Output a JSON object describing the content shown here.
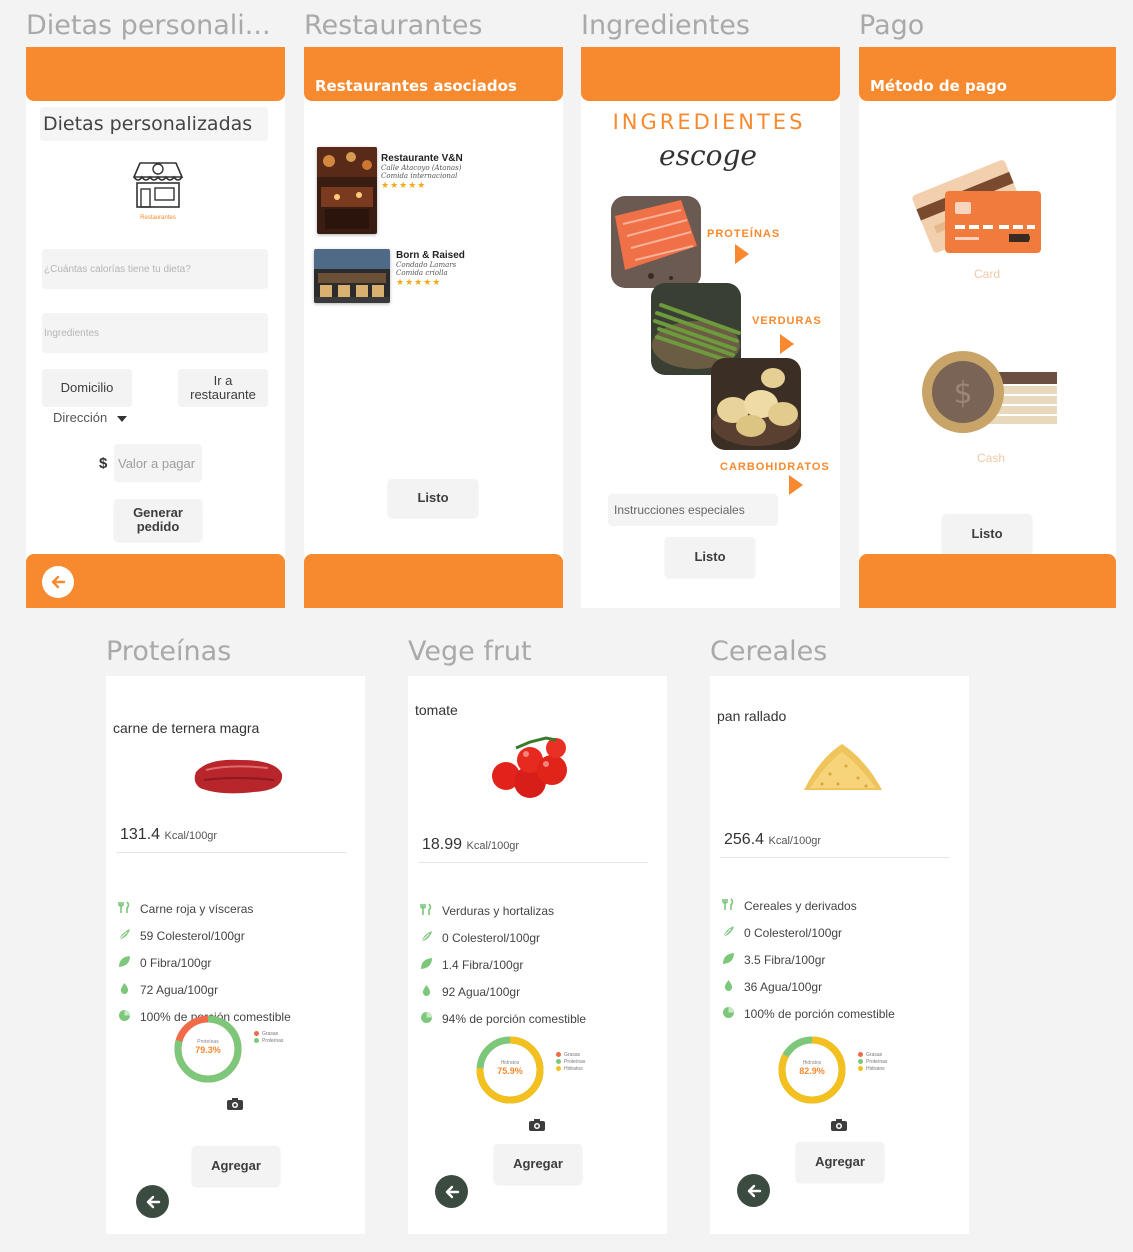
{
  "titles": {
    "dietas": "Dietas personali...",
    "restaurantes": "Restaurantes",
    "ingredientes": "Ingredientes",
    "pago": "Pago",
    "proteinas": "Proteínas",
    "vegefrut": "Vege frut",
    "cereales": "Cereales"
  },
  "dietas": {
    "heading": "Dietas personalizadas",
    "logo_caption": "Restaurantes",
    "calories_placeholder": "¿Cuántas calorías tiene tu dieta?",
    "ingredients_placeholder": "Ingredientes",
    "domicilio": "Domicilio",
    "ir_restaurante": "Ir a restaurante",
    "direccion": "Dirección",
    "currency": "$",
    "valor_placeholder": "Valor a pagar",
    "generar": "Generar pedido"
  },
  "restaurantes": {
    "header": "Restaurantes asociados",
    "items": [
      {
        "name": "Restaurante V&N",
        "line1": "Calle Atacoyo (Atanas)",
        "line2": "Comida internacional",
        "stars": "★★★★★"
      },
      {
        "name": "Born & Raised",
        "line1": "Condado Lamars",
        "line2": "Comida criolla",
        "stars": "★★★★★"
      }
    ],
    "listo": "Listo"
  },
  "ingredientes": {
    "heading": "INGREDIENTES",
    "script": "escoge",
    "proteinas": "PROTEÍNAS",
    "verduras": "VERDURAS",
    "carbohidratos": "CARBOHIDRATOS",
    "instrucciones": "Instrucciones especiales",
    "listo": "Listo"
  },
  "pago": {
    "header": "Método de pago",
    "card": "Card",
    "cash": "Cash",
    "currency": "$",
    "listo": "Listo"
  },
  "foods": [
    {
      "name": "carne de ternera magra",
      "kcal": "131.4",
      "unit": "Kcal/100gr",
      "group": "Carne roja y vísceras",
      "colesterol": "59 Colesterol/100gr",
      "fibra": "0 Fibra/100gr",
      "agua": "72 Agua/100gr",
      "porcion": "100% de porción comestible",
      "donut_title": "Proteínas",
      "donut_value": "79.3%",
      "donut_fraction": 0.793,
      "donut_color": "#7dc77b",
      "donut_rest_color": "#ef6b4a",
      "legend": [
        "Grasas",
        "Proteínas"
      ],
      "legend_colors": [
        "#ef6b4a",
        "#7dc77b"
      ],
      "agregar": "Agregar"
    },
    {
      "name": "tomate",
      "kcal": "18.99",
      "unit": "Kcal/100gr",
      "group": "Verduras y hortalizas",
      "colesterol": "0 Colesterol/100gr",
      "fibra": "1.4 Fibra/100gr",
      "agua": "92 Agua/100gr",
      "porcion": "94% de porción comestible",
      "donut_title": "Hidratos",
      "donut_value": "75.9%",
      "donut_fraction": 0.759,
      "donut_color": "#f4c020",
      "donut_rest_color": "#7dc77b",
      "legend": [
        "Grasas",
        "Proteínas",
        "Hidratos"
      ],
      "legend_colors": [
        "#ef6b4a",
        "#7dc77b",
        "#f4c020"
      ],
      "agregar": "Agregar"
    },
    {
      "name": "pan rallado",
      "kcal": "256.4",
      "unit": "Kcal/100gr",
      "group": "Cereales y derivados",
      "colesterol": "0 Colesterol/100gr",
      "fibra": "3.5 Fibra/100gr",
      "agua": "36 Agua/100gr",
      "porcion": "100% de porción comestible",
      "donut_title": "Hidratos",
      "donut_value": "82.9%",
      "donut_fraction": 0.829,
      "donut_color": "#f4c020",
      "donut_rest_color": "#7dc77b",
      "legend": [
        "Grasas",
        "Proteínas",
        "Hidratos"
      ],
      "legend_colors": [
        "#ef6b4a",
        "#7dc77b",
        "#f4c020"
      ],
      "agregar": "Agregar"
    }
  ],
  "colors": {
    "accent": "#f7892e",
    "dark_button": "#3b4b40",
    "icon_green": "#7dc77b"
  }
}
